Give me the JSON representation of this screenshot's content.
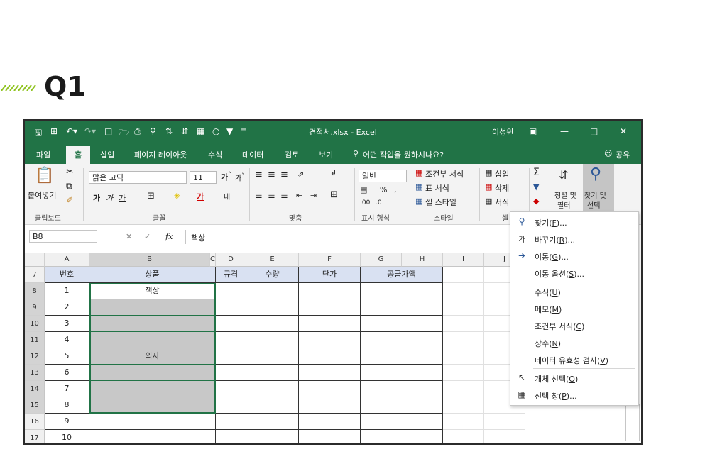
{
  "heading": {
    "title": "Q1",
    "stripe_color": "#8fc31f"
  },
  "window": {
    "title": "견적서.xlsx - Excel",
    "user": "이성원",
    "accent": "#217346"
  },
  "tabs": [
    "파일",
    "홈",
    "삽입",
    "페이지 레이아웃",
    "수식",
    "데이터",
    "검토",
    "보기"
  ],
  "tell_me": "어떤 작업을 원하시나요?",
  "share": "공유",
  "ribbon": {
    "paste": "붙여넣기",
    "font_name": "맑은 고딕",
    "font_size": "11",
    "number_format": "일반",
    "conditional_format": "조건부 서식",
    "table_format": "표 서식",
    "cell_style": "셀 스타일",
    "insert": "삽입",
    "delete": "삭제",
    "format": "서식",
    "sort_filter_1": "정렬 및",
    "sort_filter_2": "필터",
    "find_select_1": "찾기 및",
    "find_select_2": "선택",
    "groups": [
      "클립보드",
      "글꼴",
      "맞춤",
      "표시 형식",
      "스타일",
      "셀"
    ]
  },
  "formula_bar": {
    "name_box": "B8",
    "fx": "fx",
    "value": "책상"
  },
  "columns": [
    "A",
    "B",
    "C",
    "D",
    "E",
    "F",
    "G",
    "H",
    "I",
    "J"
  ],
  "rows": [
    "7",
    "8",
    "9",
    "10",
    "11",
    "12",
    "13",
    "14",
    "15",
    "16",
    "17"
  ],
  "table": {
    "headers": [
      "번호",
      "상품",
      "규격",
      "수량",
      "단가",
      "공급가액"
    ],
    "numbers": [
      "1",
      "2",
      "3",
      "4",
      "5",
      "6",
      "7",
      "8",
      "9",
      "10"
    ],
    "products": [
      "책상",
      "",
      "",
      "",
      "의자",
      "",
      "",
      "",
      "",
      ""
    ]
  },
  "menu": {
    "find": "찾기",
    "find_key": "F",
    "replace": "바꾸기",
    "replace_key": "R",
    "goto": "이동",
    "goto_key": "G",
    "goto_special": "이동 옵션",
    "goto_special_key": "S",
    "formulas": "수식",
    "formulas_key": "U",
    "notes": "메모",
    "notes_key": "M",
    "cond_format": "조건부 서식",
    "cond_format_key": "C",
    "constants": "상수",
    "constants_key": "N",
    "validation": "데이터 유효성 검사",
    "validation_key": "V",
    "select_objects": "개체 선택",
    "select_objects_key": "O",
    "selection_pane": "선택 창",
    "selection_pane_key": "P"
  }
}
